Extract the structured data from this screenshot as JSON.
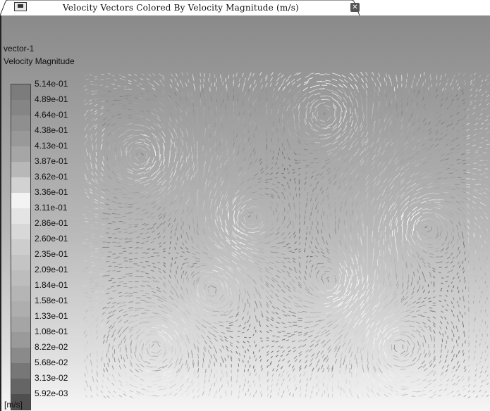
{
  "window": {
    "title": "Velocity Vectors Colored By Velocity Magnitude (m/s)",
    "close_glyph": "✕"
  },
  "legend": {
    "name": "vector-1",
    "field": "Velocity Magnitude",
    "units": "[m/s]",
    "labels": [
      "5.14e-01",
      "4.89e-01",
      "4.64e-01",
      "4.38e-01",
      "4.13e-01",
      "3.87e-01",
      "3.62e-01",
      "3.36e-01",
      "3.11e-01",
      "2.86e-01",
      "2.60e-01",
      "2.35e-01",
      "2.09e-01",
      "1.84e-01",
      "1.58e-01",
      "1.33e-01",
      "1.08e-01",
      "8.22e-02",
      "5.68e-02",
      "3.13e-02",
      "5.92e-03"
    ],
    "colors": [
      "#7c7c7c",
      "#858585",
      "#8f8f8f",
      "#999999",
      "#a6a6a6",
      "#b8b8b8",
      "#d2d2d2",
      "#f3f3f3",
      "#e4e4e4",
      "#d8d8d8",
      "#cdcdcd",
      "#c4c4c4",
      "#bdbdbd",
      "#b5b5b5",
      "#aeaeae",
      "#a5a5a5",
      "#9a9a9a",
      "#8a8a8a",
      "#777777",
      "#656565",
      "#4f4f4f"
    ]
  },
  "icons": {
    "window_icon": "graphics-window-icon",
    "close": "close-icon"
  }
}
